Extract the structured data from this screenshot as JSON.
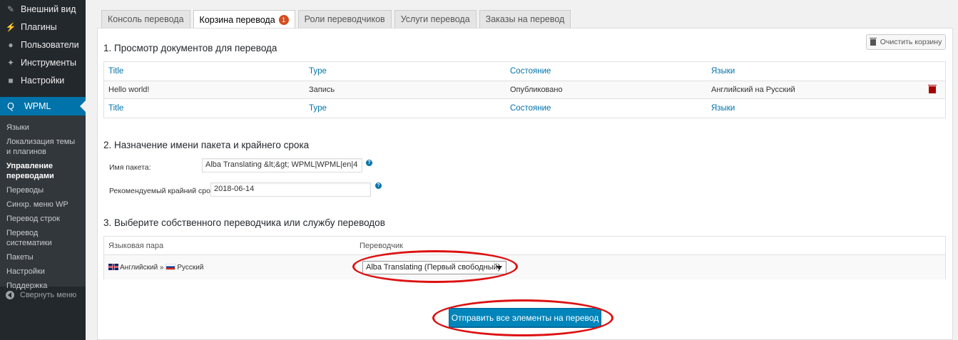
{
  "sidebar": {
    "items": [
      {
        "label": "Внешний вид",
        "icon": "paintbrush-icon"
      },
      {
        "label": "Плагины",
        "icon": "plugin-icon"
      },
      {
        "label": "Пользователи",
        "icon": "user-icon"
      },
      {
        "label": "Инструменты",
        "icon": "wrench-icon"
      },
      {
        "label": "Настройки",
        "icon": "settings-icon"
      }
    ],
    "active": {
      "label": "WPML",
      "icon": "wpml-icon"
    },
    "submenu": [
      "Языки",
      "Локализация темы и плагинов",
      "Управление переводами",
      "Переводы",
      "Синхр. меню WP",
      "Перевод строк",
      "Перевод систематики",
      "Пакеты",
      "Настройки",
      "Поддержка"
    ],
    "collapse": "Свернуть меню"
  },
  "tabs": [
    {
      "label": "Консоль перевода"
    },
    {
      "label": "Корзина перевода",
      "badge": "1"
    },
    {
      "label": "Роли переводчиков"
    },
    {
      "label": "Услуги перевода"
    },
    {
      "label": "Заказы на перевод"
    }
  ],
  "clear_button": "Очистить корзину",
  "section1": {
    "title": "1. Просмотр документов для перевода",
    "columns": [
      "Title",
      "Type",
      "Состояние",
      "Языки"
    ],
    "rows": [
      [
        "Hello world!",
        "Запись",
        "Опубликовано",
        "Английский на Русский"
      ]
    ]
  },
  "section2": {
    "title": "2. Назначение имени пакета и крайнего срока",
    "batch_label": "Имя пакета:",
    "batch_value": "Alba Translating &lt;&gt; WPML|WPML|en|4",
    "deadline_label": "Рекомендуемый крайний срок:",
    "deadline_value": "2018-06-14",
    "help": "?"
  },
  "section3": {
    "title": "3. Выберите собственного переводчика или службу переводов",
    "col_pair": "Языковая пара",
    "col_translator": "Переводчик",
    "from_lang": "Английский",
    "arrow": "»",
    "to_lang": "Русский",
    "translator_selected": "Alba Translating (Первый свободный)"
  },
  "send_button": "Отправить все элементы на перевод",
  "colors": {
    "accent": "#0073aa",
    "highlight": "#dd1111"
  }
}
